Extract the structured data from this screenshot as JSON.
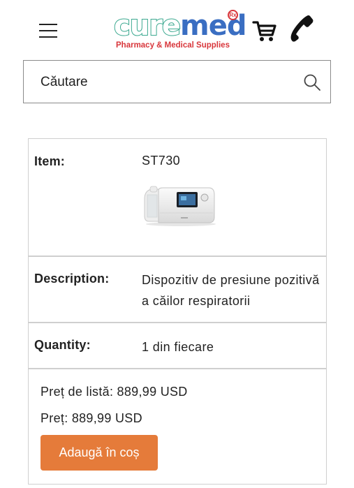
{
  "header": {
    "logo": {
      "word_part1": "cure",
      "word_part2": "med",
      "rx_mark": "Rx",
      "tagline": "Pharmacy & Medical Supplies"
    },
    "icons": {
      "menu": "hamburger-menu-icon",
      "cart": "shopping-cart-icon",
      "phone": "phone-icon"
    }
  },
  "search": {
    "placeholder": "Căutare",
    "icon": "search-icon"
  },
  "product_table": {
    "item_label": "Item:",
    "item_value": "ST730",
    "description_label": "Description:",
    "description_value": "Dispozitiv de presiune pozitivă a căilor respiratorii",
    "quantity_label": "Quantity:",
    "quantity_value": "1 din fiecare",
    "list_price": "Preț de listă: 889,99 USD",
    "price": "Preț: 889,99 USD",
    "add_to_cart_label": "Adaugă în coș"
  },
  "colors": {
    "brand_green": "#3aa88f",
    "brand_blue": "#3a6ec2",
    "brand_red": "#d8363b",
    "button_orange": "#e57b3a"
  }
}
